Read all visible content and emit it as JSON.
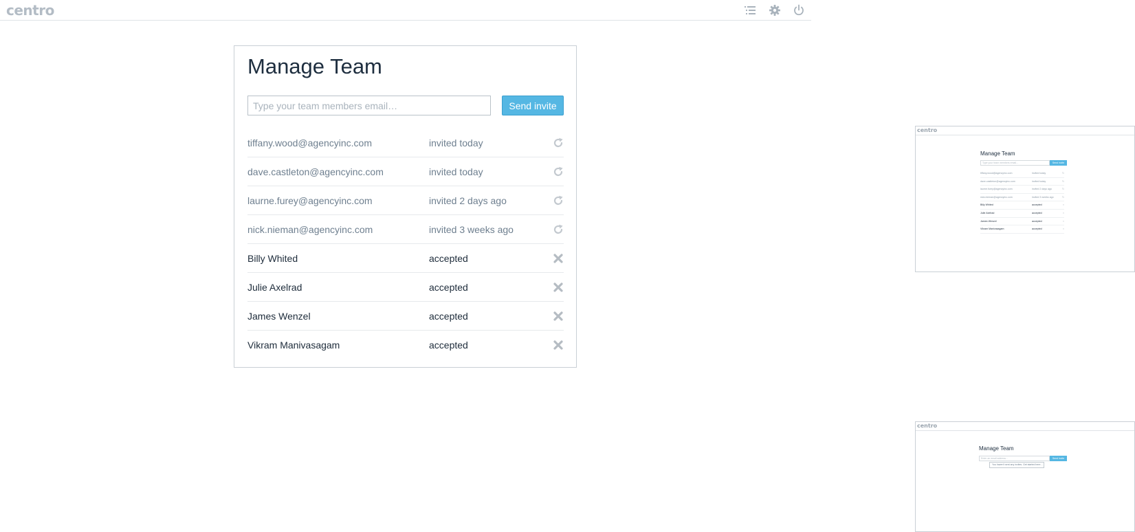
{
  "app": {
    "logo": "centro"
  },
  "topbar": {
    "icons": [
      "list-icon",
      "gear-icon",
      "power-icon"
    ]
  },
  "colors": {
    "accent": "#55b7e3",
    "muted_icon": "#b5bcc3",
    "pending_text": "#6e7f8f",
    "member_text": "#1d2b3a"
  },
  "team": {
    "title": "Manage Team",
    "input_placeholder": "Type your team members email…",
    "send_label": "Send invite",
    "rows": [
      {
        "name": "tiffany.wood@agencyinc.com",
        "status": "invited today",
        "kind": "pending",
        "icon": "resend-icon"
      },
      {
        "name": "dave.castleton@agencyinc.com",
        "status": "invited today",
        "kind": "pending",
        "icon": "resend-icon"
      },
      {
        "name": "laurne.furey@agencyinc.com",
        "status": "invited 2 days ago",
        "kind": "pending",
        "icon": "resend-icon"
      },
      {
        "name": "nick.nieman@agencyinc.com",
        "status": "invited 3 weeks ago",
        "kind": "pending",
        "icon": "resend-icon"
      },
      {
        "name": "Billy Whited",
        "status": "accepted",
        "kind": "member",
        "icon": "remove-icon"
      },
      {
        "name": "Julie Axelrad",
        "status": "accepted",
        "kind": "member",
        "icon": "remove-icon"
      },
      {
        "name": "James Wenzel",
        "status": "accepted",
        "kind": "member",
        "icon": "remove-icon"
      },
      {
        "name": "Vikram Manivasagam",
        "status": "accepted",
        "kind": "member",
        "icon": "remove-icon"
      }
    ]
  },
  "thumbnail_1": {
    "logo": "centro",
    "title": "Manage Team",
    "input_placeholder": "Type your team members email…",
    "send_label": "Send invite",
    "rows": [
      {
        "name": "tiffany.wood@agencyinc.com",
        "status": "invited today",
        "kind": "pending"
      },
      {
        "name": "dave.castleton@agencyinc.com",
        "status": "invited today",
        "kind": "pending"
      },
      {
        "name": "laurne.furey@agencyinc.com",
        "status": "invited 2 days ago",
        "kind": "pending"
      },
      {
        "name": "nick.nieman@agencyinc.com",
        "status": "invited 3 weeks ago",
        "kind": "pending"
      },
      {
        "name": "Billy Whited",
        "status": "accepted",
        "kind": "member"
      },
      {
        "name": "Julie Axelrad",
        "status": "accepted",
        "kind": "member"
      },
      {
        "name": "James Wenzel",
        "status": "accepted",
        "kind": "member"
      },
      {
        "name": "Vikram Manivasagam",
        "status": "accepted",
        "kind": "member"
      }
    ]
  },
  "thumbnail_2": {
    "logo": "centro",
    "title": "Manage Team",
    "input_placeholder": "Enter an email address…",
    "send_label": "Send invite",
    "tooltip": "You haven't sent any invites. Get started here…"
  }
}
